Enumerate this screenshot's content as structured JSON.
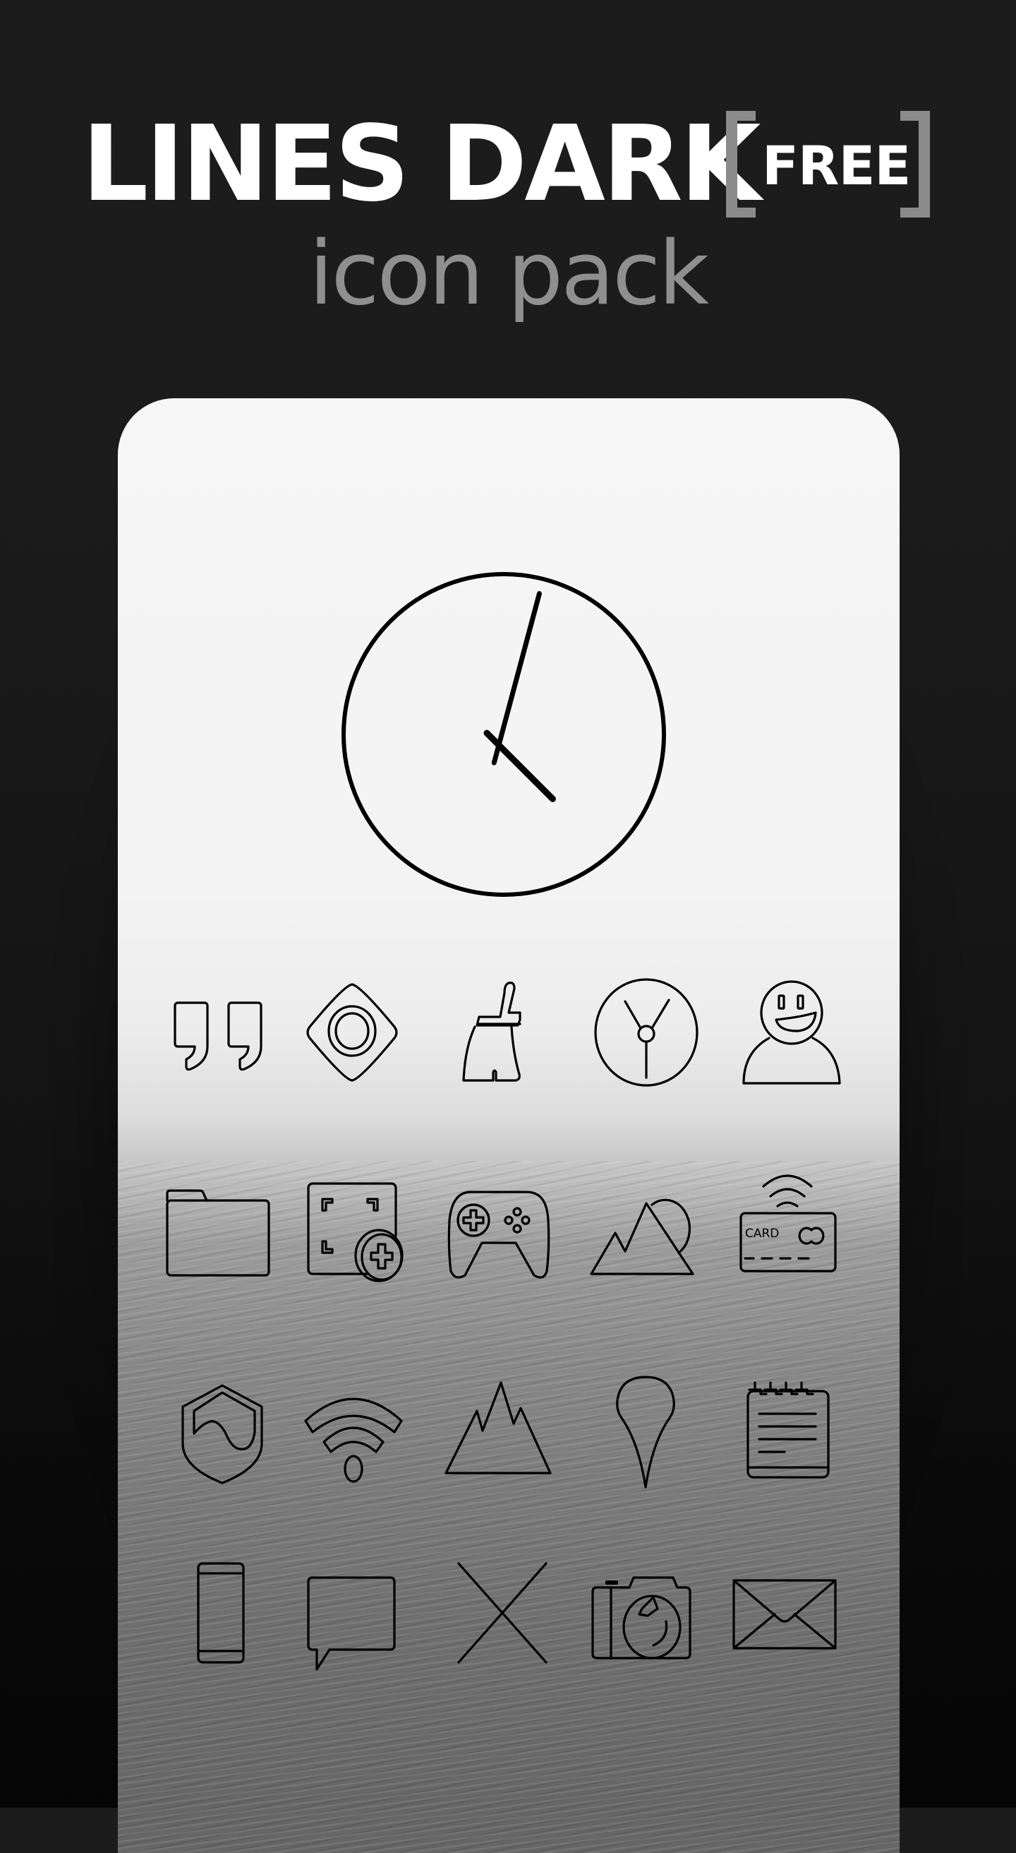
{
  "header": {
    "title": "LINES DARK",
    "badge": "FREE",
    "subtitle": "icon pack"
  },
  "colors": {
    "background": "#1c1c1c",
    "title": "#ffffff",
    "accent_gray": "#8b8b8b",
    "card_top": "#f6f6f6",
    "card_bottom": "#666666",
    "icon_stroke": "#000000"
  },
  "clock_widget": {
    "name": "analog-clock",
    "hour_hand_angle_deg": 135,
    "minute_hand_angle_deg": 15
  },
  "icon_grid": {
    "rows": [
      [
        "quotes-icon",
        "eye-diamond-icon",
        "broom-cleaner-icon",
        "clock-y-icon",
        "smiley-user-icon"
      ],
      [
        "folder-icon",
        "screenshot-add-icon",
        "gamepad-icon",
        "gallery-mountain-sun-icon",
        "contactless-card-icon"
      ],
      [
        "shield-icon",
        "wifi-icon",
        "mountain-peaks-icon",
        "map-pin-icon",
        "notepad-icon"
      ],
      [
        "phone-icon",
        "chat-bubble-icon",
        "x-cross-icon",
        "camera-icon",
        "mail-envelope-icon"
      ]
    ],
    "card_icon_text": "CARD"
  }
}
